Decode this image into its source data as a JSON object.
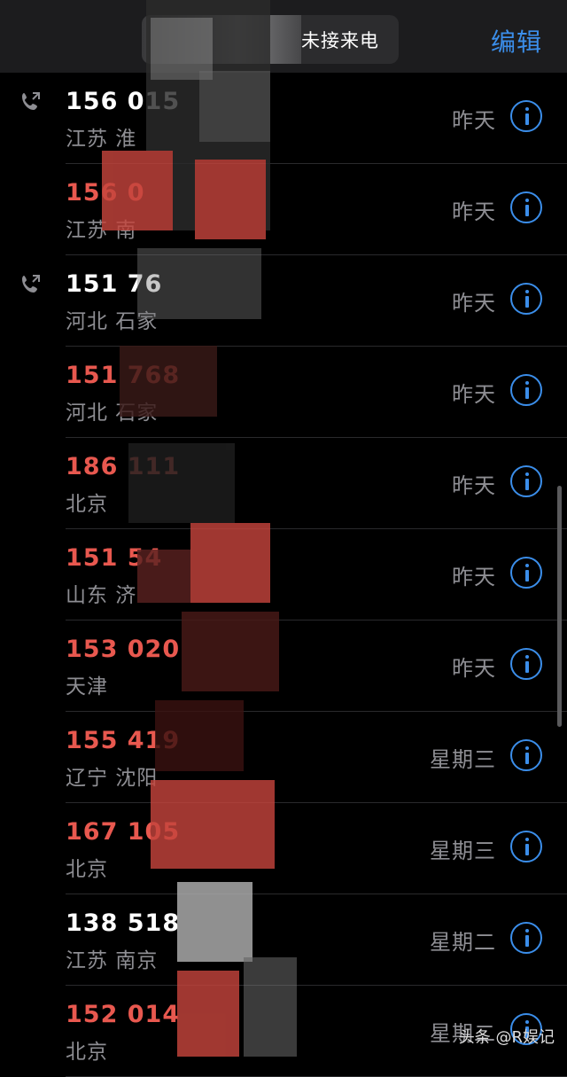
{
  "header": {
    "filter_label": "未接来电",
    "edit_label": "编辑"
  },
  "calls": [
    {
      "number": "156 015",
      "location": "江苏 淮",
      "time": "昨天",
      "missed": false,
      "outgoing": true
    },
    {
      "number": "156 0",
      "location": "江苏 南",
      "time": "昨天",
      "missed": true,
      "outgoing": false
    },
    {
      "number": "151 76",
      "location": "河北 石家",
      "time": "昨天",
      "missed": false,
      "outgoing": true
    },
    {
      "number": "151 768",
      "location": "河北 石家",
      "time": "昨天",
      "missed": true,
      "outgoing": false
    },
    {
      "number": "186 111",
      "location": "北京",
      "time": "昨天",
      "missed": true,
      "outgoing": false
    },
    {
      "number": "151 54",
      "location": "山东 济",
      "time": "昨天",
      "missed": true,
      "outgoing": false
    },
    {
      "number": "153 020",
      "location": "天津",
      "time": "昨天",
      "missed": true,
      "outgoing": false
    },
    {
      "number": "155 419",
      "location": "辽宁 沈阳",
      "time": "星期三",
      "missed": true,
      "outgoing": false
    },
    {
      "number": "167 105",
      "location": "北京",
      "time": "星期三",
      "missed": true,
      "outgoing": false
    },
    {
      "number": "138 518",
      "location": "江苏 南京",
      "time": "星期二",
      "missed": false,
      "outgoing": false
    },
    {
      "number": "152 014",
      "location": "北京",
      "time": "星期二",
      "missed": true,
      "outgoing": false
    }
  ],
  "watermark": "头条 @R娱记",
  "colors": {
    "accent": "#3b8eea",
    "missed": "#e8584f",
    "background": "#000000"
  }
}
